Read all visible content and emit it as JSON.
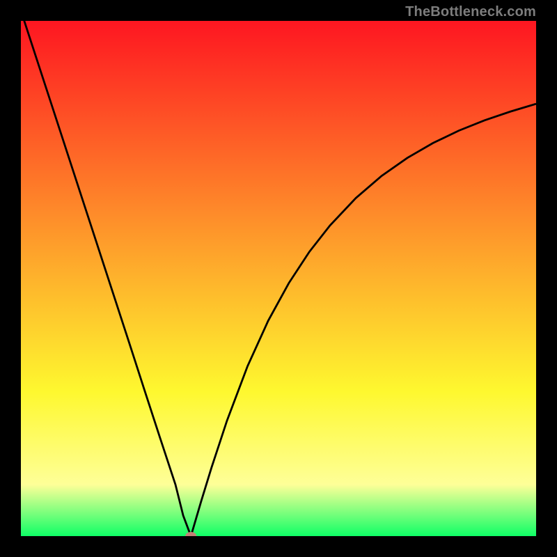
{
  "attribution": "TheBottleneck.com",
  "colors": {
    "gradient_top": "#fe1621",
    "gradient_mid1": "#fe8d2a",
    "gradient_mid2": "#fef82f",
    "gradient_band": "#feff98",
    "gradient_bottom": "#0fff66",
    "curve": "#000000",
    "marker": "#c48177",
    "frame": "#000000"
  },
  "chart_data": {
    "type": "line",
    "title": "",
    "xlabel": "",
    "ylabel": "",
    "xlim": [
      0,
      100
    ],
    "ylim": [
      0,
      100
    ],
    "series": [
      {
        "name": "bottleneck-curve",
        "x": [
          0,
          3,
          6,
          9,
          12,
          15,
          18,
          21,
          24,
          27,
          30,
          31.5,
          33,
          35,
          37,
          40,
          44,
          48,
          52,
          56,
          60,
          65,
          70,
          75,
          80,
          85,
          90,
          95,
          100
        ],
        "values": [
          102,
          92.8,
          83.6,
          74.4,
          65.2,
          56.0,
          46.8,
          37.6,
          28.3,
          19.1,
          10.0,
          4.0,
          0.0,
          6.8,
          13.3,
          22.4,
          33.0,
          41.8,
          49.1,
          55.2,
          60.3,
          65.6,
          69.9,
          73.4,
          76.3,
          78.7,
          80.7,
          82.4,
          83.9
        ]
      }
    ],
    "annotations": [
      {
        "name": "minimum-marker",
        "x": 33,
        "y": 0
      }
    ]
  }
}
